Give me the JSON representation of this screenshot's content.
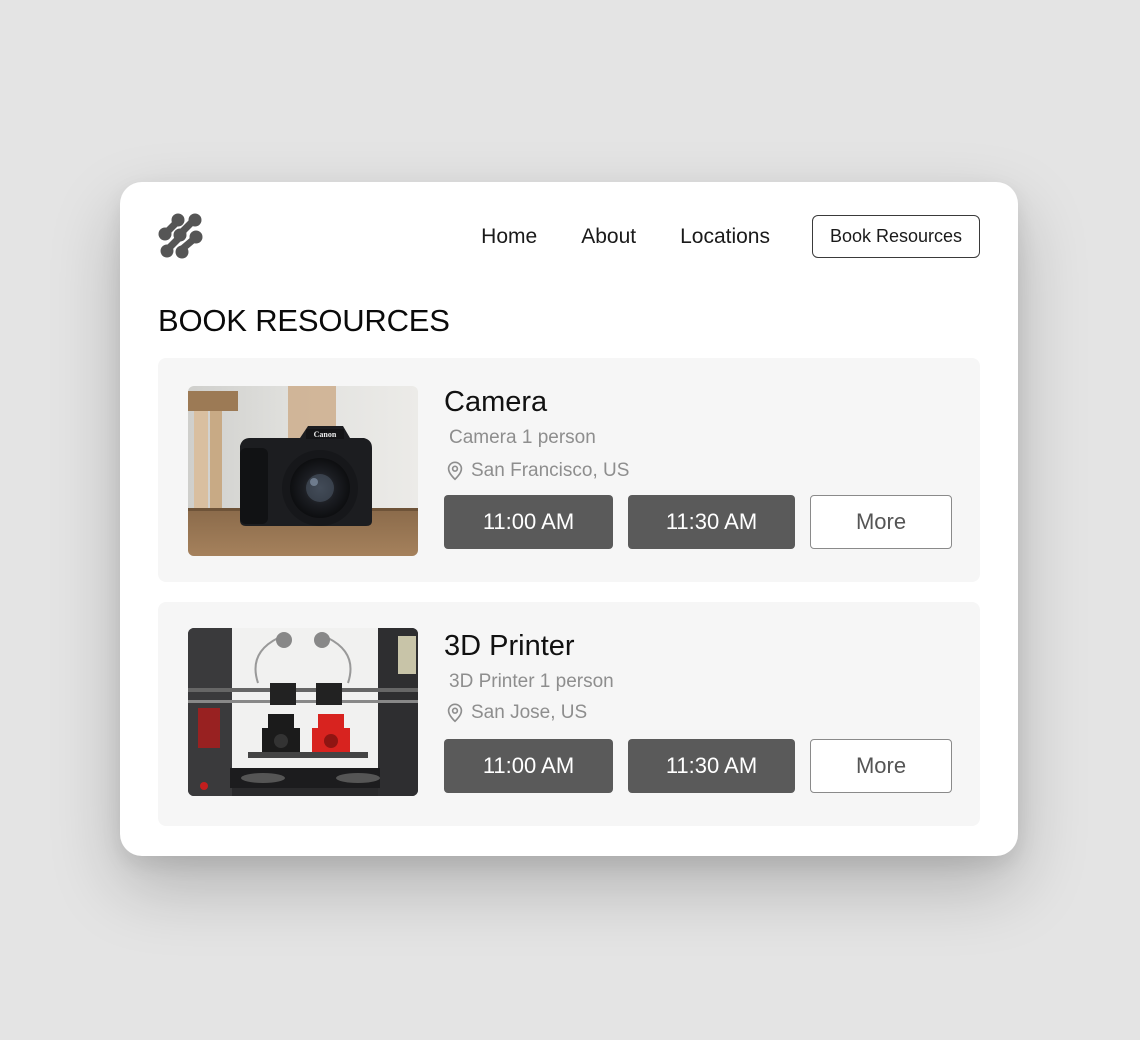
{
  "header": {
    "logo": "brand-logo-icon",
    "nav": [
      {
        "label": "Home"
      },
      {
        "label": "About"
      },
      {
        "label": "Locations"
      }
    ],
    "cta_label": "Book Resources"
  },
  "page_title": "BOOK RESOURCES",
  "resources": [
    {
      "title": "Camera",
      "subtitle": "Camera 1 person",
      "location": "San Francisco, US",
      "image": "camera-photo",
      "slots": [
        "11:00 AM",
        "11:30 AM"
      ],
      "more_label": "More"
    },
    {
      "title": "3D Printer",
      "subtitle": "3D Printer 1 person",
      "location": "San Jose, US",
      "image": "3d-printer-photo",
      "slots": [
        "11:00 AM",
        "11:30 AM"
      ],
      "more_label": "More"
    }
  ],
  "colors": {
    "background": "#e4e4e4",
    "card": "#f6f6f6",
    "slot_button": "#5a5a5a",
    "muted_text": "#8e8e8e"
  }
}
